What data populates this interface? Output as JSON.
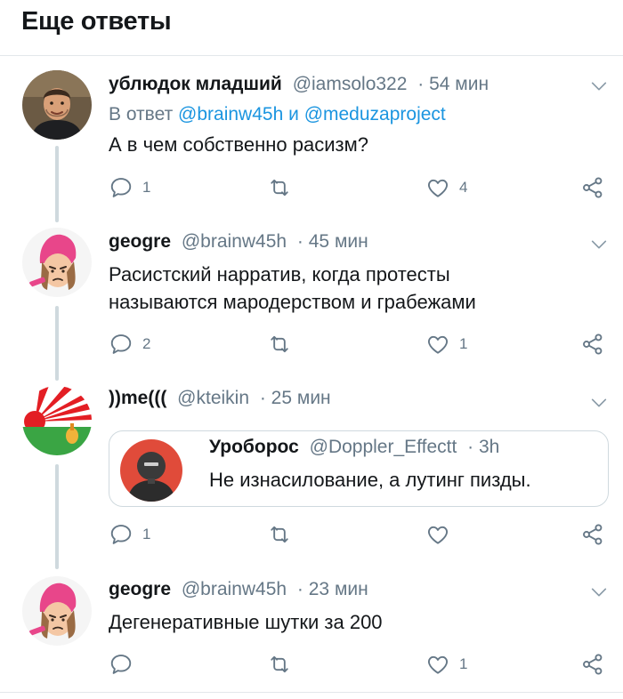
{
  "page": {
    "title": "Еще ответы"
  },
  "tweets": [
    {
      "author_name": "ублюдок младший",
      "handle": "@iamsolo322",
      "time": "· 54 мин",
      "reply_prefix": "В ответ",
      "reply_to_1": "@brainw45h",
      "reply_join": "и",
      "reply_to_2": "@meduzaproject",
      "text": "А в чем собственно расизм?",
      "reply_count": "1",
      "retweet_count": "",
      "like_count": "4"
    },
    {
      "author_name": "geogre",
      "handle": "@brainw45h",
      "time": "· 45 мин",
      "text_line1": "Расистский нарратив, когда протесты",
      "text_line2": "называются мародерством и грабежами",
      "reply_count": "2",
      "retweet_count": "",
      "like_count": "1"
    },
    {
      "author_name": "))me(((",
      "handle": "@kteikin",
      "time": "· 25 мин",
      "quote": {
        "author_name": "Уроборос",
        "handle": "@Doppler_Effectt",
        "time": "· 3h",
        "text": "Не изнасилование, а лутинг пизды."
      },
      "reply_count": "1",
      "retweet_count": "",
      "like_count": ""
    },
    {
      "author_name": "geogre",
      "handle": "@brainw45h",
      "time": "· 23 мин",
      "text": "Дегенеративные шутки за 200",
      "reply_count": "",
      "retweet_count": "",
      "like_count": "1"
    }
  ],
  "icons": {
    "reply": "reply-icon",
    "retweet": "retweet-icon",
    "like": "heart-icon",
    "share": "share-icon",
    "more": "chevron-down-icon"
  },
  "colors": {
    "text": "#14171a",
    "muted": "#657786",
    "link": "#1b95e0",
    "border": "#e3e7ea",
    "thread": "#cfd9de"
  }
}
